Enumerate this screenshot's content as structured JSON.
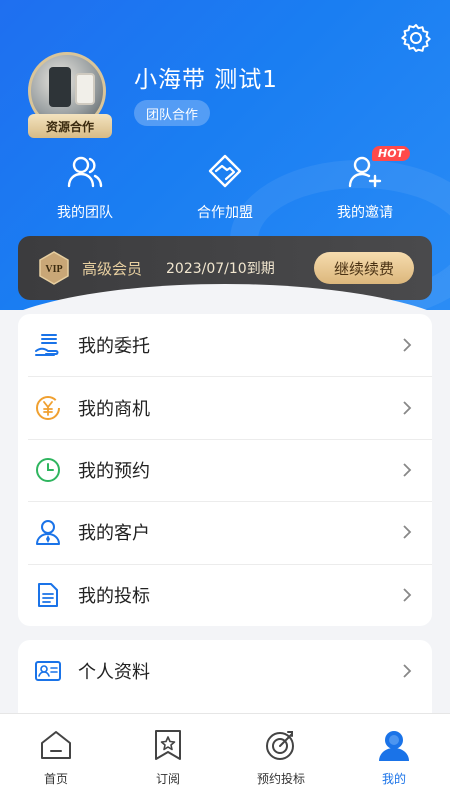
{
  "header": {
    "user_name": "小海带 测试1",
    "avatar_badge": "资源合作",
    "team_tag": "团队合作"
  },
  "quick_actions": [
    {
      "label": "我的团队",
      "icon": "team-icon"
    },
    {
      "label": "合作加盟",
      "icon": "handshake-icon"
    },
    {
      "label": "我的邀请",
      "icon": "invite-icon",
      "badge": "HOT"
    }
  ],
  "vip": {
    "icon_text": "VIP",
    "level": "高级会员",
    "expire": "2023/07/10到期",
    "renew_label": "继续续费"
  },
  "menu": [
    {
      "label": "我的委托",
      "icon": "entrust-icon"
    },
    {
      "label": "我的商机",
      "icon": "yuan-icon"
    },
    {
      "label": "我的预约",
      "icon": "clock-icon"
    },
    {
      "label": "我的客户",
      "icon": "customer-icon"
    },
    {
      "label": "我的投标",
      "icon": "bid-document-icon"
    }
  ],
  "menu2": [
    {
      "label": "个人资料",
      "icon": "id-card-icon"
    }
  ],
  "tabs": [
    {
      "label": "首页",
      "icon": "home-icon"
    },
    {
      "label": "订阅",
      "icon": "bookmark-star-icon"
    },
    {
      "label": "预约投标",
      "icon": "target-icon"
    },
    {
      "label": "我的",
      "icon": "person-icon",
      "active": true
    }
  ],
  "colors": {
    "primary": "#1a73e8",
    "header_gradient_start": "#1f6ff0",
    "vip_bar": "#3c3c3e",
    "vip_gold": "#e7cfa0",
    "hot_badge": "#ff4a4a"
  }
}
